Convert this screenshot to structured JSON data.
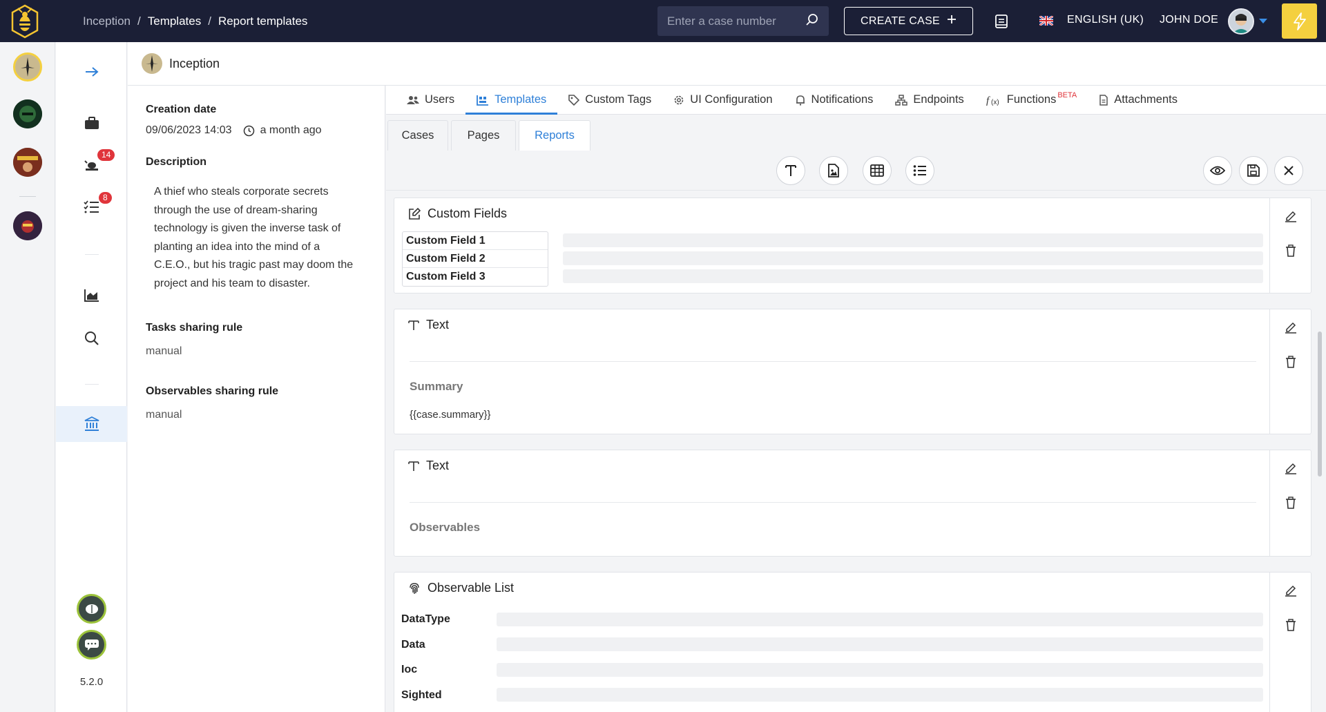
{
  "header": {
    "breadcrumb": [
      "Inception",
      "Templates",
      "Report templates"
    ],
    "search_placeholder": "Enter a case number",
    "create_case_label": "CREATE CASE",
    "language": "ENGLISH (UK)",
    "user_name": "JOHN DOE"
  },
  "nav": {
    "alerts_badge": "14",
    "tasks_badge": "8",
    "version": "5.2.0"
  },
  "org": {
    "name": "Inception"
  },
  "details": {
    "creation_date_label": "Creation date",
    "creation_date": "09/06/2023 14:03",
    "relative_time": "a month ago",
    "description_label": "Description",
    "description": "A thief who steals corporate secrets through the use of dream-sharing technology is given the inverse task of planting an idea into the mind of a C.E.O., but his tragic past may doom the project and his team to disaster.",
    "tasks_rule_label": "Tasks sharing rule",
    "tasks_rule": "manual",
    "observables_rule_label": "Observables sharing rule",
    "observables_rule": "manual"
  },
  "tabs": [
    {
      "label": "Users"
    },
    {
      "label": "Templates"
    },
    {
      "label": "Custom Tags"
    },
    {
      "label": "UI Configuration"
    },
    {
      "label": "Notifications"
    },
    {
      "label": "Endpoints"
    },
    {
      "label": "Functions",
      "badge": "BETA"
    },
    {
      "label": "Attachments"
    }
  ],
  "subtabs": [
    "Cases",
    "Pages",
    "Reports"
  ],
  "blocks": {
    "custom_fields": {
      "title": "Custom Fields",
      "fields": [
        "Custom Field 1",
        "Custom Field 2",
        "Custom Field 3"
      ]
    },
    "text1": {
      "title": "Text",
      "heading": "Summary",
      "body": "{{case.summary}}"
    },
    "text2": {
      "title": "Text",
      "heading": "Observables"
    },
    "observable_list": {
      "title": "Observable List",
      "columns": [
        "DataType",
        "Data",
        "Ioc",
        "Sighted"
      ]
    }
  },
  "colors": {
    "topbar": "#1b1f36",
    "accent": "#2f80d8",
    "badge": "#e0353b",
    "bolt": "#f4d03f"
  }
}
